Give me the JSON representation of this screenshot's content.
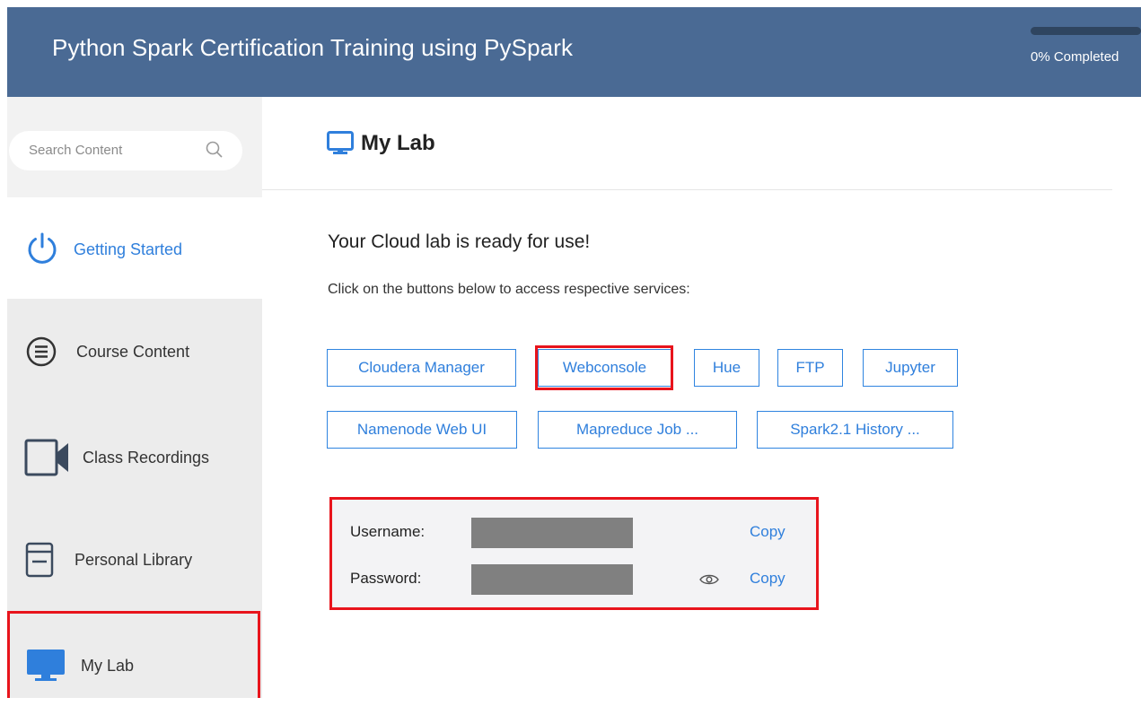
{
  "header": {
    "title": "Python Spark Certification Training using PySpark",
    "progress_text": "0% Completed",
    "progress_percent": 0
  },
  "sidebar": {
    "search": {
      "placeholder": "Search Content"
    },
    "items": [
      {
        "label": "Getting Started",
        "icon": "power-icon"
      },
      {
        "label": "Course Content",
        "icon": "list-icon"
      },
      {
        "label": "Class Recordings",
        "icon": "video-camera-icon"
      },
      {
        "label": "Personal Library",
        "icon": "book-icon"
      },
      {
        "label": "My Lab",
        "icon": "monitor-icon"
      }
    ]
  },
  "main": {
    "title": "My Lab",
    "ready_text": "Your Cloud lab is ready for use!",
    "instructions": "Click on the buttons below to access respective services:",
    "services": [
      "Cloudera Manager",
      "Webconsole",
      "Hue",
      "FTP",
      "Jupyter",
      "Namenode Web UI",
      "Mapreduce Job ...",
      "Spark2.1 History ..."
    ],
    "credentials": {
      "username_label": "Username:",
      "password_label": "Password:",
      "copy_label": "Copy"
    }
  },
  "colors": {
    "header_bg": "#4a6a94",
    "accent": "#2f7fdc",
    "highlight": "#e8141c"
  }
}
